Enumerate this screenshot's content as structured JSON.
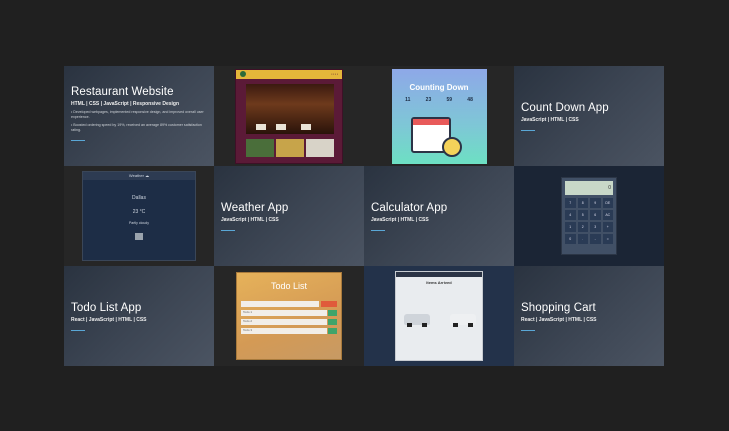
{
  "projects": [
    {
      "title": "Restaurant Website",
      "tech": "HTML | CSS | JavaScript | Responsive Design",
      "bullets": [
        "• Developed webpages, implemented responsive design, and improved overall user experience.",
        "• Boosted ordering speed by 19%, received an average 89% customer satisfaction rating."
      ]
    },
    {
      "title": "Count Down App",
      "tech": "JavaScript | HTML | CSS"
    },
    {
      "title": "Weather App",
      "tech": "JavaScript | HTML | CSS"
    },
    {
      "title": "Calculator App",
      "tech": "JavaScript | HTML | CSS"
    },
    {
      "title": "Todo List App",
      "tech": "React | JavaScript | HTML | CSS"
    },
    {
      "title": "Shopping Cart",
      "tech": "React | JavaScript | HTML | CSS"
    }
  ],
  "thumbs": {
    "countdown": {
      "heading": "Counting Down",
      "nums": [
        "11",
        "23",
        "59",
        "48"
      ]
    },
    "weather": {
      "title": "Weather ☁",
      "city": "Dallas",
      "temp": "23 °C",
      "cond": "Partly cloudy"
    },
    "calculator": {
      "display": "0",
      "keys": [
        "7",
        "8",
        "9",
        "DE",
        "4",
        "5",
        "6",
        "AC",
        "1",
        "2",
        "3",
        "+",
        "0",
        ".",
        "-",
        "="
      ]
    },
    "todo": {
      "heading": "Todo List",
      "items": [
        "Todo 1",
        "Todo 2",
        "Todo 3"
      ]
    },
    "shop": {
      "heading": "Items Arrived"
    }
  },
  "colors": {
    "background": "#202020",
    "accent_underline": "#5aa7d6"
  }
}
